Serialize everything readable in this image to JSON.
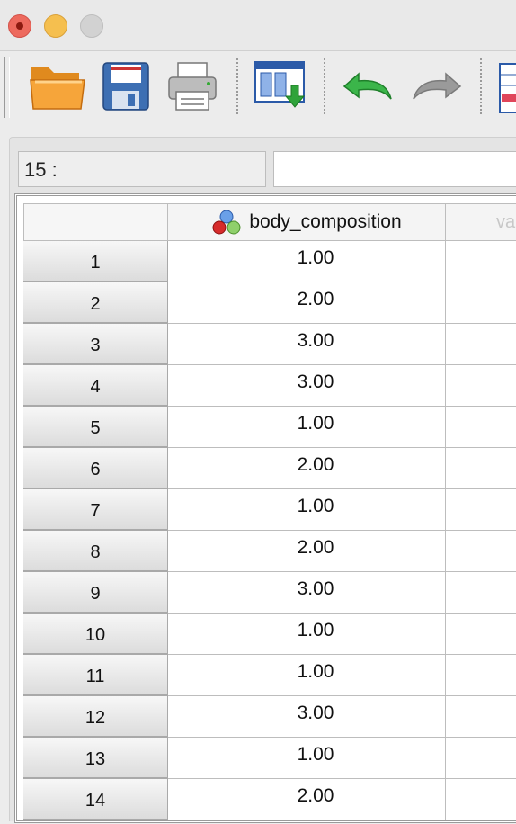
{
  "window": {
    "controls": [
      "close",
      "minimize",
      "maximize"
    ]
  },
  "toolbar": {
    "buttons": [
      {
        "icon": "open-folder-icon"
      },
      {
        "icon": "save-disk-icon"
      },
      {
        "icon": "printer-icon"
      },
      {
        "icon": "import-data-icon"
      },
      {
        "icon": "undo-icon"
      },
      {
        "icon": "redo-icon"
      }
    ]
  },
  "cell_reference": {
    "label": "15 :",
    "value": ""
  },
  "grid": {
    "columns": [
      {
        "name": "body_composition",
        "icon": "nominal-variable-icon"
      },
      {
        "name": "va"
      }
    ],
    "rows": [
      {
        "num": "1",
        "value": "1.00"
      },
      {
        "num": "2",
        "value": "2.00"
      },
      {
        "num": "3",
        "value": "3.00"
      },
      {
        "num": "4",
        "value": "3.00"
      },
      {
        "num": "5",
        "value": "1.00"
      },
      {
        "num": "6",
        "value": "2.00"
      },
      {
        "num": "7",
        "value": "1.00"
      },
      {
        "num": "8",
        "value": "2.00"
      },
      {
        "num": "9",
        "value": "3.00"
      },
      {
        "num": "10",
        "value": "1.00"
      },
      {
        "num": "11",
        "value": "1.00"
      },
      {
        "num": "12",
        "value": "3.00"
      },
      {
        "num": "13",
        "value": "1.00"
      },
      {
        "num": "14",
        "value": "2.00"
      }
    ]
  }
}
